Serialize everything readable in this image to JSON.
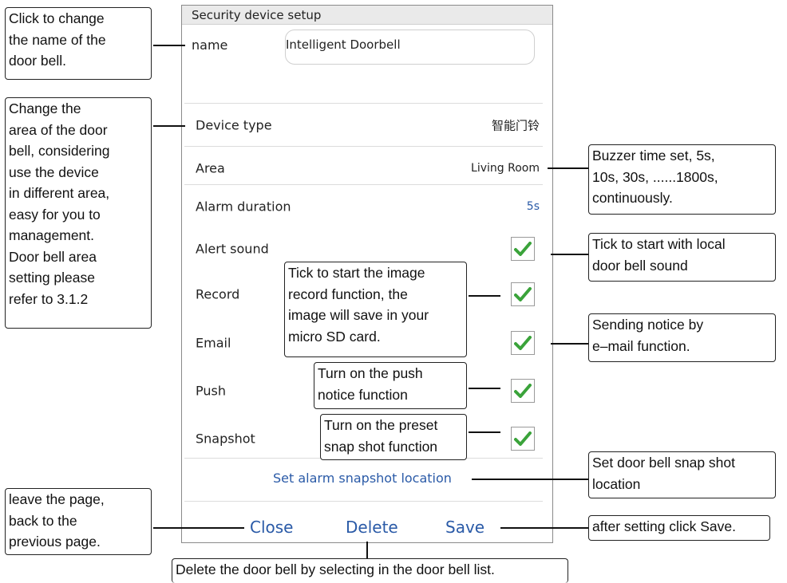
{
  "screen": {
    "title": "Security device setup",
    "name_label": "name",
    "name_value": "Intelligent Doorbell",
    "rows": [
      {
        "label": "Device type",
        "value": "智能门铃"
      },
      {
        "label": "Area",
        "value": "Living Room"
      },
      {
        "label": "Alarm duration",
        "value": "5s"
      },
      {
        "label": "Alert sound",
        "checked": true
      },
      {
        "label": "Record",
        "checked": true
      },
      {
        "label": "Email",
        "checked": true
      },
      {
        "label": "Push",
        "checked": true
      },
      {
        "label": "Snapshot",
        "checked": true
      }
    ],
    "snapshot_link": "Set alarm snapshot location",
    "buttons": {
      "close": "Close",
      "delete": "Delete",
      "save": "Save"
    },
    "check_color": "#3aa33a"
  },
  "callouts": {
    "name": [
      "Click to change",
      "the name of the",
      "door bell."
    ],
    "area": [
      "Change the",
      "area of the door",
      "bell, considering",
      "use the device",
      "in different area,",
      "easy for you to",
      "management.",
      "Door bell area",
      "setting please",
      "refer to 3.1.2"
    ],
    "buzzer": [
      "Buzzer time set, 5s,",
      "10s, 30s, ......1800s,",
      "continuously."
    ],
    "alert": [
      "Tick to start with local",
      "door bell sound"
    ],
    "record": [
      "Tick to start the image",
      "record function, the",
      "image will save in your",
      "micro SD card."
    ],
    "email": [
      "Sending notice by",
      "e–mail function."
    ],
    "push": [
      "Turn on the push",
      "notice function"
    ],
    "snapshot": [
      "Turn on the preset",
      "snap shot function"
    ],
    "location": [
      "Set door bell snap shot",
      "location"
    ],
    "close": [
      "leave the page,",
      "back to the",
      "previous page."
    ],
    "save": [
      "after setting click Save."
    ],
    "delete": [
      "Delete the door bell by selecting in the door bell list."
    ]
  }
}
